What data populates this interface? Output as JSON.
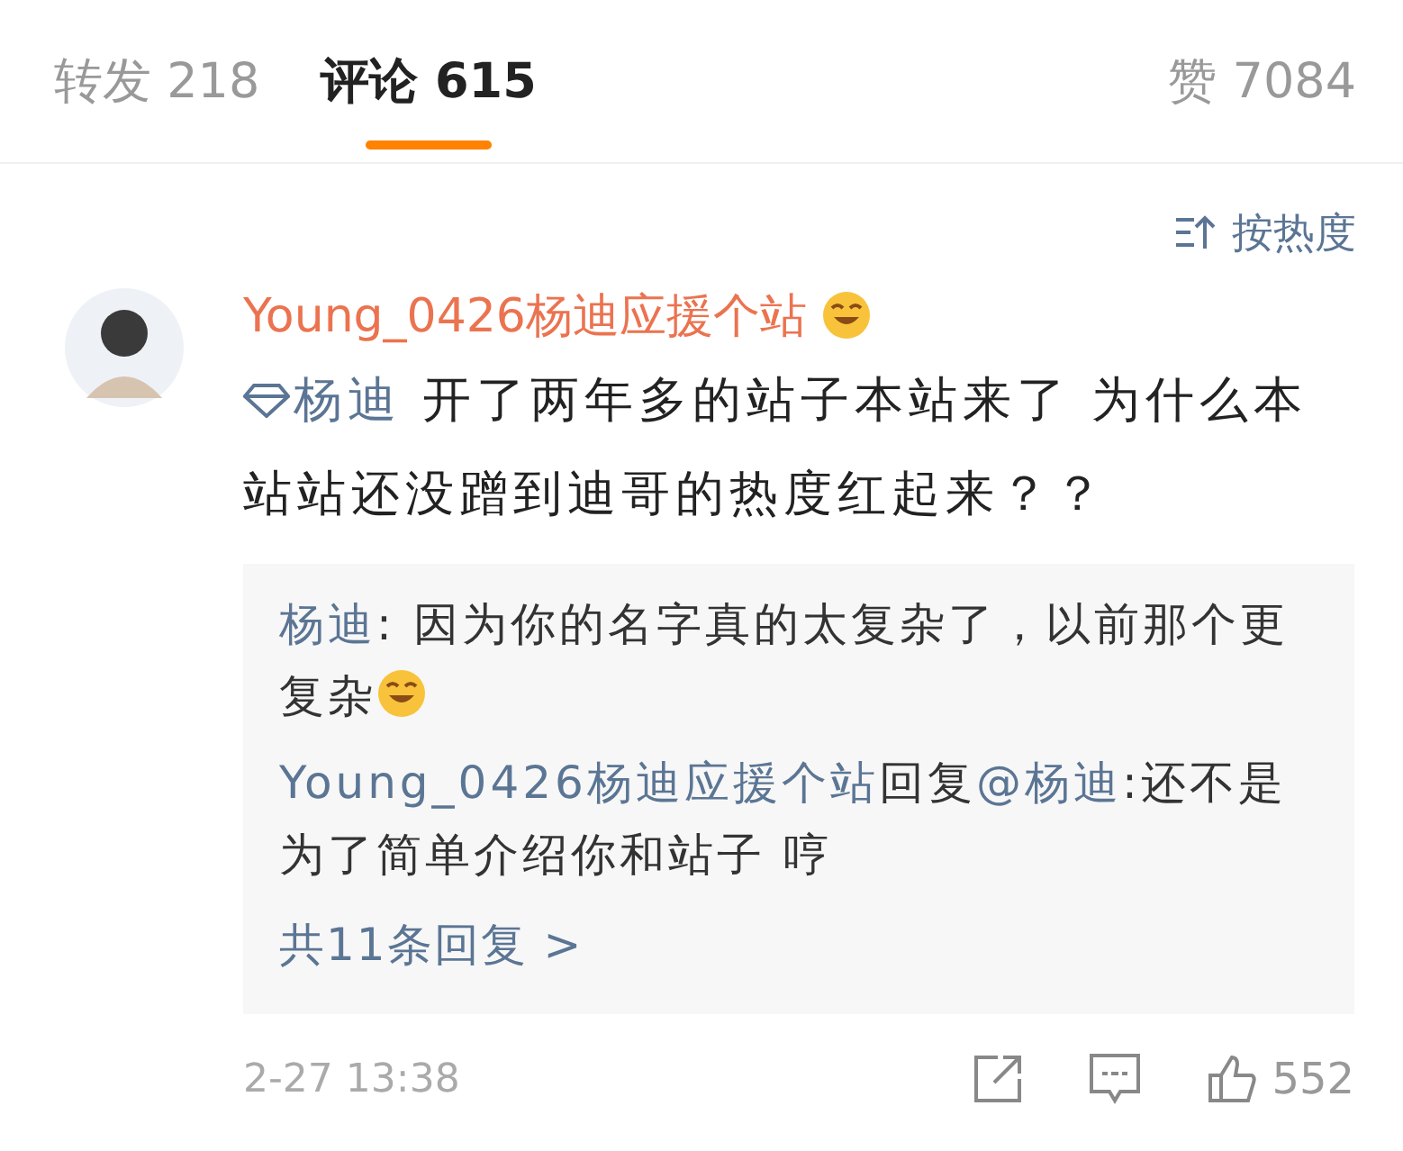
{
  "tabs": [
    {
      "label": "转发 218",
      "selected": false
    },
    {
      "label": "评论 615",
      "selected": true
    },
    {
      "label": "赞 7084",
      "selected": false
    }
  ],
  "sort": {
    "label": "按热度"
  },
  "comment": {
    "author": "Young_0426杨迪应援个站",
    "mention": "杨迪",
    "text": " 开了两年多的站子本站来了 为什么本站站还没蹭到迪哥的热度红起来？？",
    "replies": [
      {
        "segments": [
          {
            "kind": "name",
            "text": "杨迪"
          },
          {
            "kind": "plain",
            "text": ": 因为你的名字真的太复杂了，以前那个更复杂"
          },
          {
            "kind": "emoji"
          }
        ]
      },
      {
        "segments": [
          {
            "kind": "name",
            "text": "Young_0426杨迪应援个站"
          },
          {
            "kind": "plain",
            "text": "回复"
          },
          {
            "kind": "name",
            "text": "@杨迪"
          },
          {
            "kind": "plain",
            "text": ":还不是为了简单介绍你和站子 哼"
          }
        ]
      }
    ],
    "more_replies": "共11条回复 >",
    "time": "2-27 13:38",
    "likes": "552"
  }
}
